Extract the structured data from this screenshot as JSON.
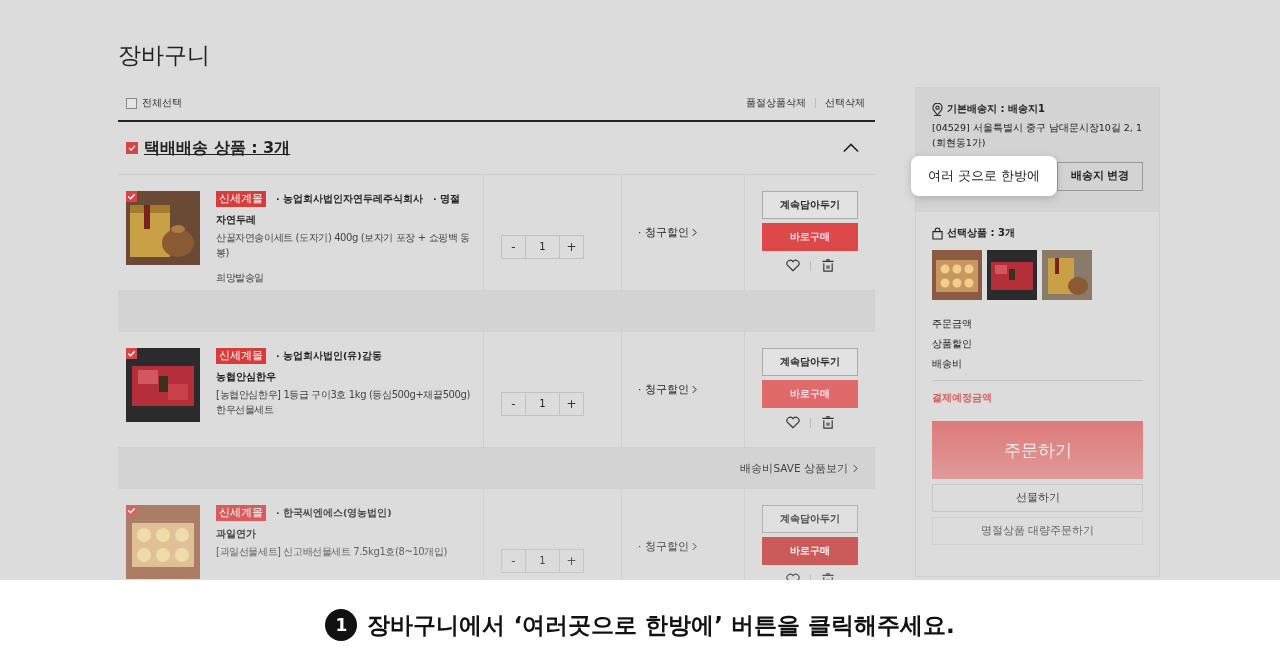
{
  "page_title": "장바구니",
  "select_all": {
    "label": "전체선택",
    "checked": false
  },
  "top_actions": [
    "품절상품삭제",
    "선택삭제"
  ],
  "group": {
    "title": "택배배송 상품 : 3개",
    "checked": true,
    "expanded": true
  },
  "items": [
    {
      "checked": true,
      "badge": "신세계몰",
      "sellers": [
        "· 농업회사법인자연두레주식회사",
        "· 명절"
      ],
      "name": "자연두레",
      "option": "산꿀자연송이세트 (도자기) 400g (보자기 포장 + 쇼핑백 동봉)",
      "extra": "희망발송일",
      "minus": "-",
      "qty": "1",
      "plus": "+",
      "discount": "· 청구할인",
      "keep": "계속담아두기",
      "buy": "바로구매",
      "faded": false
    },
    {
      "checked": true,
      "badge": "신세계몰",
      "sellers": [
        "· 농업회사법인(유)감동"
      ],
      "name": "농협안심한우",
      "option": "[농협안심한우] 1등급 구이3호 1kg (등심500g+채끝500g) 한우선물세트",
      "minus": "-",
      "qty": "1",
      "plus": "+",
      "discount": "· 청구할인",
      "keep": "계속담아두기",
      "buy": "바로구매",
      "faded": false
    },
    {
      "checked": true,
      "badge": "신세계몰",
      "sellers": [
        "· 한국씨엔에스(영농법인)"
      ],
      "name": "과일연가",
      "option": "[과일선물세트] 신고배선물세트 7.5kg1호(8~10개입)",
      "minus": "-",
      "qty": "1",
      "plus": "+",
      "discount": "· 청구할인",
      "keep": "계속담아두기",
      "buy": "바로구매",
      "faded": true
    }
  ],
  "save_link": "배송비SAVE 상품보기",
  "sidebar": {
    "address_title": "기본배송지 : 배송지1",
    "address": "[04529] 서울특별시 중구 남대문시장10길 2, 1 (회현동1가)",
    "multi_button": "여러 곳으로 한방에",
    "change_button": "배송지 변경",
    "selected_title": "선택상품 : 3개",
    "summary": [
      "주문금액",
      "상품할인",
      "배송비"
    ],
    "total_label": "결제예정금액",
    "order_button": "주문하기",
    "gift_button": "선물하기",
    "bulk_button": "명절상품 대량주문하기"
  },
  "caption": {
    "step": "1",
    "text": "장바구니에서 ‘여러곳으로 한방에’ 버튼을 클릭해주세요."
  }
}
